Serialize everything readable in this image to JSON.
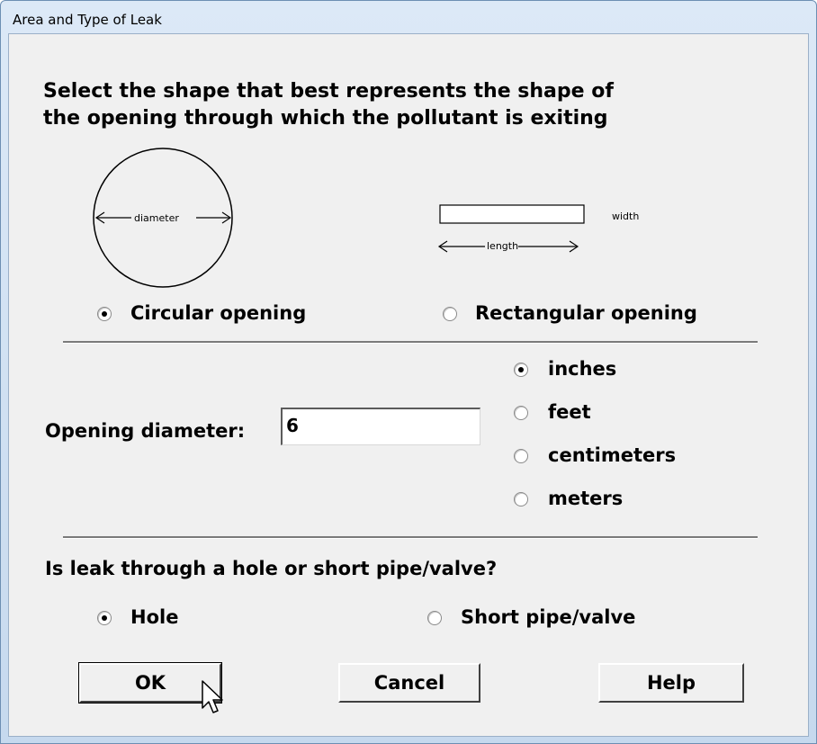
{
  "window": {
    "title": "Area and Type of Leak"
  },
  "shape_section": {
    "instruction_line1": "Select the shape that best represents the shape of",
    "instruction_line2": "the opening through which the pollutant is exiting",
    "circle_label": "diameter",
    "rect_width_label": "width",
    "rect_length_label": "length",
    "circular_option": "Circular opening",
    "rectangular_option": "Rectangular opening",
    "selected": "Circular opening"
  },
  "dimension_section": {
    "label": "Opening diameter:",
    "value": "6",
    "units": [
      "inches",
      "feet",
      "centimeters",
      "meters"
    ],
    "selected_unit": "inches"
  },
  "leak_type_section": {
    "question": "Is leak through a hole or short pipe/valve?",
    "options": [
      "Hole",
      "Short pipe/valve"
    ],
    "selected": "Hole"
  },
  "buttons": {
    "ok": "OK",
    "cancel": "Cancel",
    "help": "Help"
  }
}
